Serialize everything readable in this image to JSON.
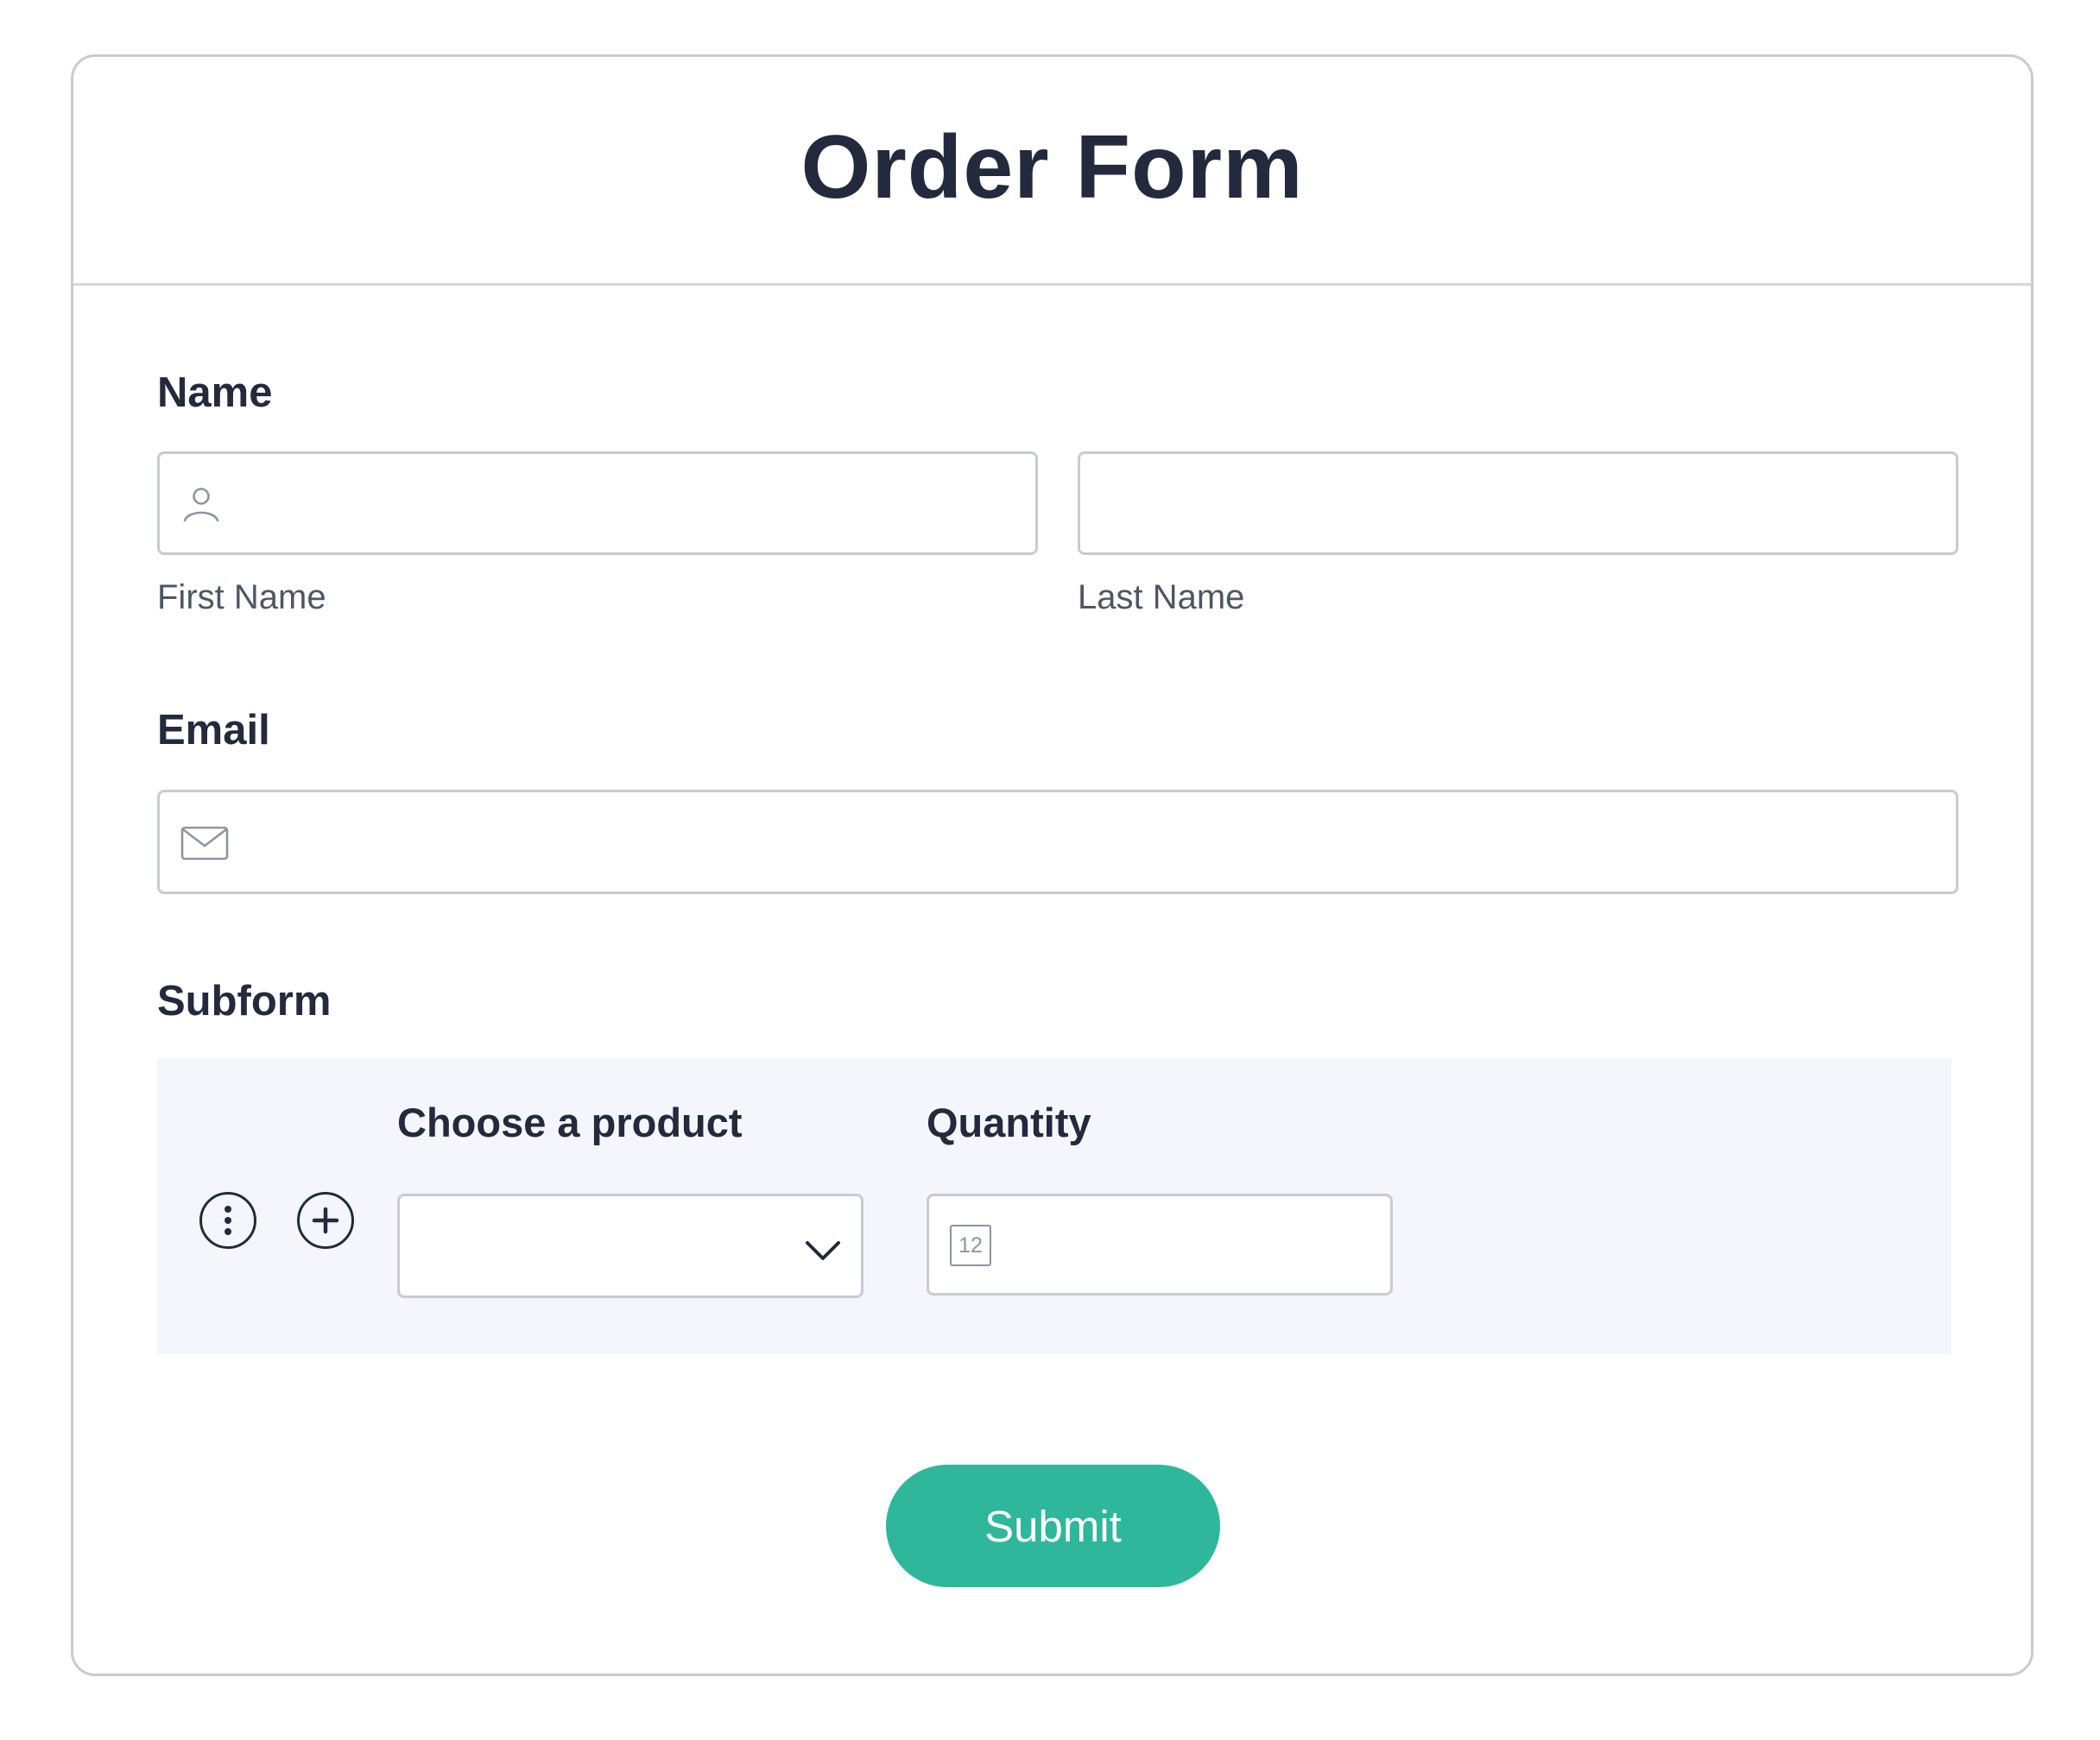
{
  "form": {
    "title": "Order Form"
  },
  "name_field": {
    "label": "Name",
    "first_name": {
      "value": "",
      "sublabel": "First Name",
      "icon": "user-icon"
    },
    "last_name": {
      "value": "",
      "sublabel": "Last Name"
    }
  },
  "email_field": {
    "label": "Email",
    "value": "",
    "icon": "envelope-icon"
  },
  "subform": {
    "label": "Subform",
    "row_actions": {
      "more_icon": "more-vertical-icon",
      "add_icon": "add-circle-icon"
    },
    "product": {
      "label": "Choose a product",
      "selected": "",
      "icon": "chevron-down-icon"
    },
    "quantity": {
      "label": "Quantity",
      "value": "",
      "icon_text": "12",
      "icon": "number-icon"
    }
  },
  "submit": {
    "label": "Submit"
  },
  "colors": {
    "text": "#232a3d",
    "border": "#c8cad6",
    "subform_bg": "#f4f6fb",
    "submit_bg": "#2eb79a"
  }
}
